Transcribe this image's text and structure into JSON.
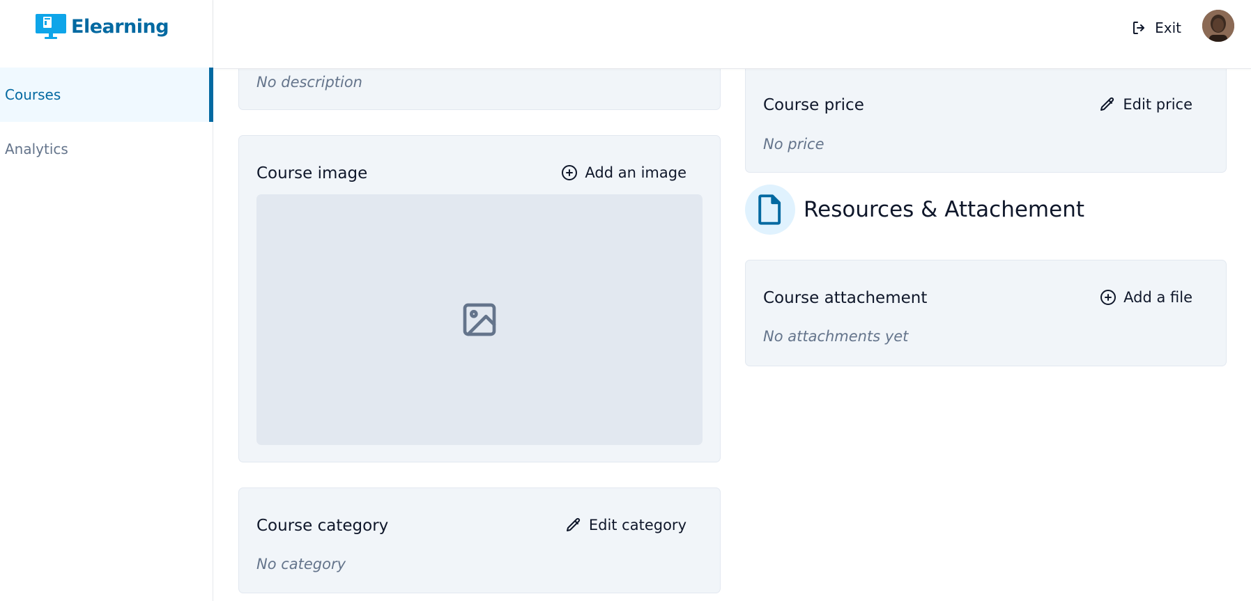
{
  "app": {
    "name": "Elearning"
  },
  "sidebar": {
    "items": [
      {
        "label": "Courses",
        "active": true
      },
      {
        "label": "Analytics",
        "active": false
      }
    ]
  },
  "topbar": {
    "exit_label": "Exit"
  },
  "description_card": {
    "empty_text": "No description"
  },
  "image_card": {
    "title": "Course image",
    "action_label": "Add an image"
  },
  "category_card": {
    "title": "Course category",
    "action_label": "Edit category",
    "empty_text": "No category"
  },
  "price_card": {
    "title": "Course price",
    "action_label": "Edit price",
    "empty_text": "No price"
  },
  "resources_section": {
    "title": "Resources & Attachement"
  },
  "attachment_card": {
    "title": "Course attachement",
    "action_label": "Add a file",
    "empty_text": "No attachments yet"
  },
  "colors": {
    "brand": "#0369a1",
    "card_bg": "#f1f5f9",
    "muted_text": "#64748b",
    "active_nav_bg": "#f0f9ff"
  }
}
